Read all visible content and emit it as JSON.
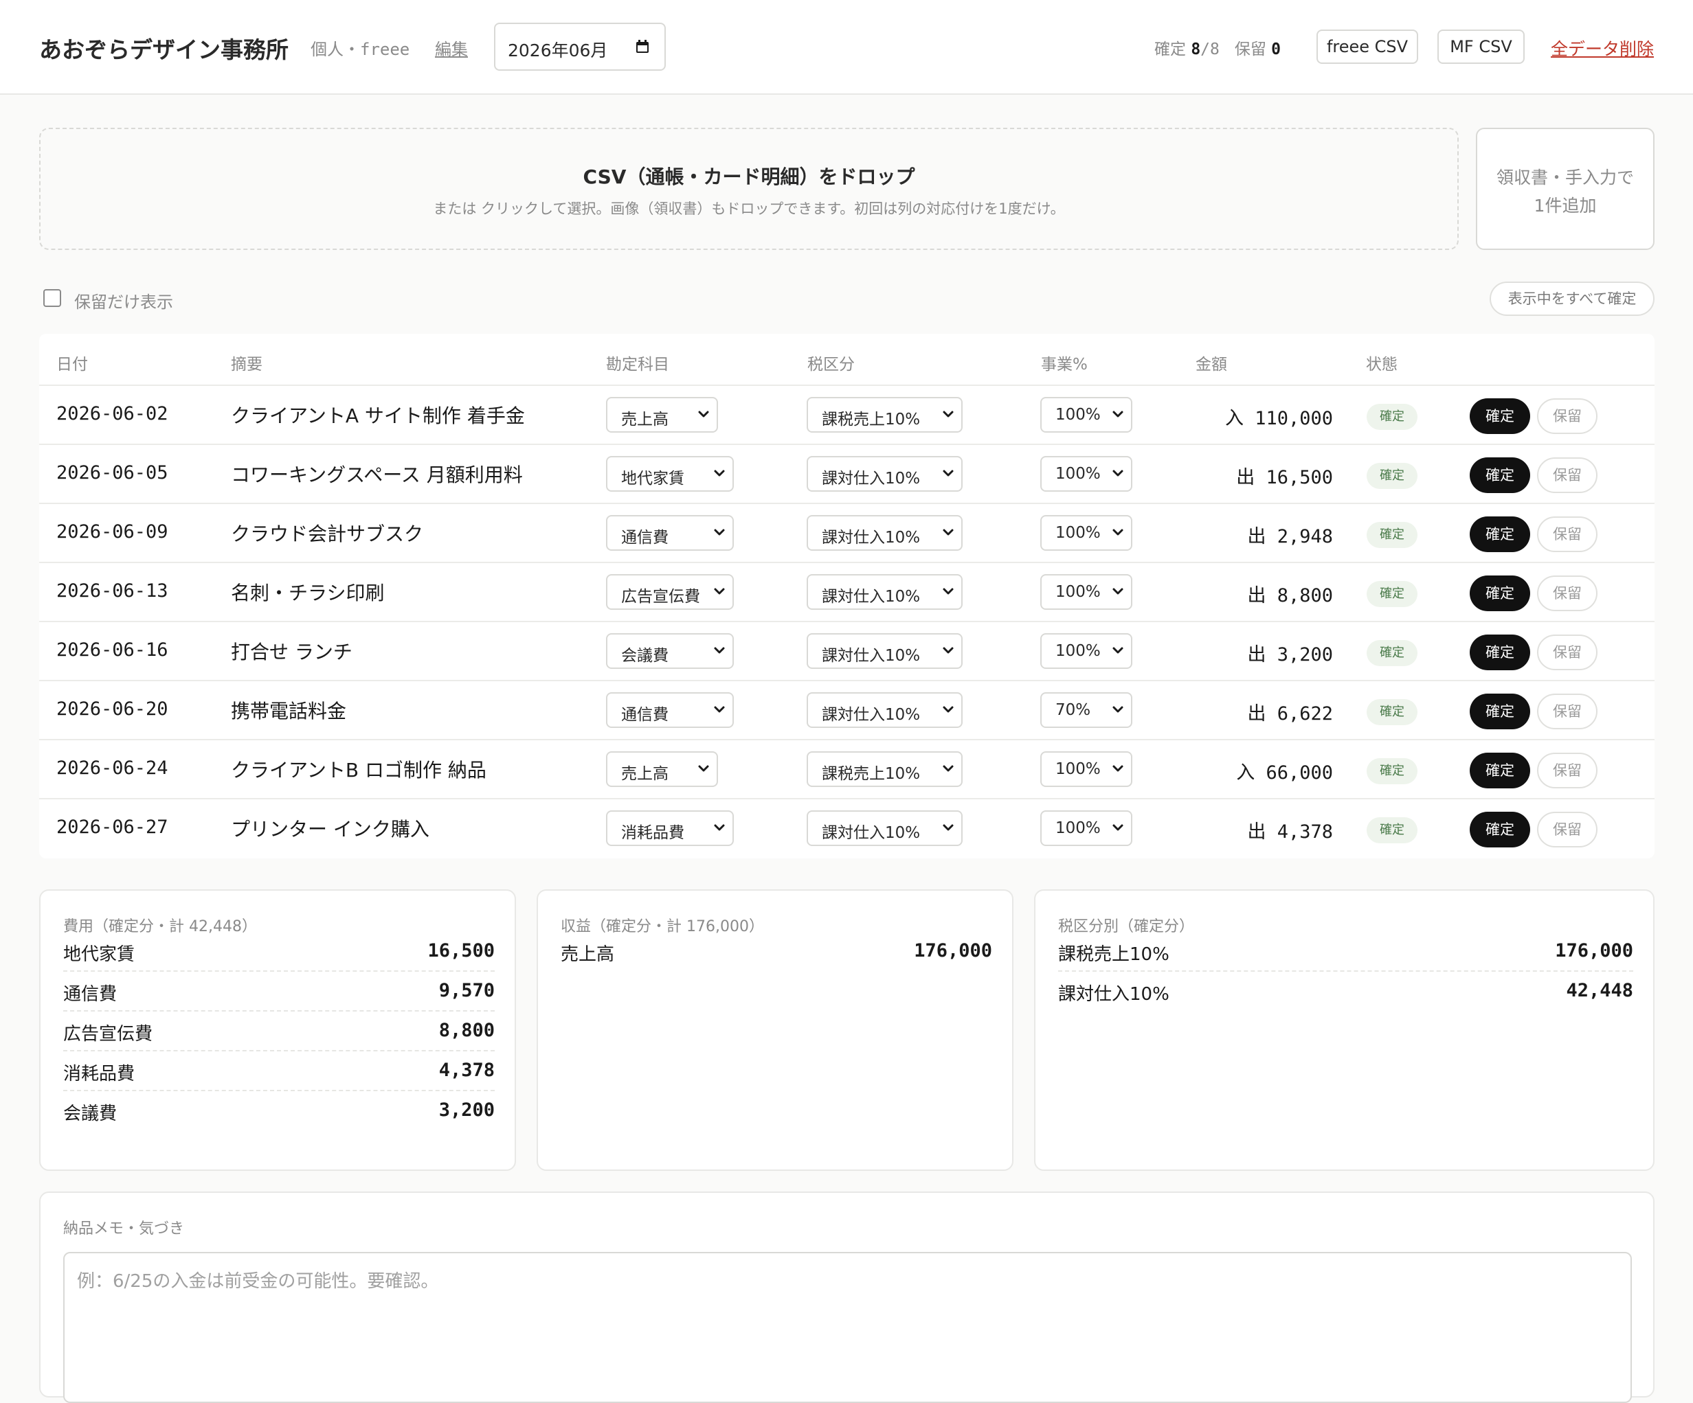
{
  "header": {
    "title": "あおぞらデザイン事務所",
    "profile": "個人・freee",
    "edit_label": "編集",
    "month": "2026年06月",
    "confirmed_label": "確定",
    "confirmed_count": "8",
    "total_count": "/8",
    "hold_label": "保留",
    "hold_count": "0",
    "freee_csv": "freee CSV",
    "mf_csv": "MF CSV",
    "delete_all": "全データ削除"
  },
  "dropzone": {
    "title": "CSV（通帳・カード明細）をドロップ",
    "subtitle": "または クリックして選択。画像（領収書）もドロップできます。初回は列の対応付けを1度だけ。"
  },
  "manual_add": {
    "line1": "領収書・手入力で",
    "line2": "1件追加"
  },
  "filter": {
    "hold_only": "保留だけ表示",
    "confirm_all": "表示中をすべて確定"
  },
  "table": {
    "headers": {
      "date": "日付",
      "desc": "摘要",
      "account": "勘定科目",
      "tax": "税区分",
      "biz": "事業%",
      "amount": "金額",
      "status": "状態"
    },
    "rows": [
      {
        "date": "2026-06-02",
        "desc": "クライアントA サイト制作 着手金",
        "account": "売上高",
        "tax": "課税売上10%",
        "biz": "100%",
        "amount": "入 110,000",
        "status": "確定",
        "confirm": "確定",
        "hold": "保留"
      },
      {
        "date": "2026-06-05",
        "desc": "コワーキングスペース 月額利用料",
        "account": "地代家賃",
        "tax": "課対仕入10%",
        "biz": "100%",
        "amount": "出 16,500",
        "status": "確定",
        "confirm": "確定",
        "hold": "保留"
      },
      {
        "date": "2026-06-09",
        "desc": "クラウド会計サブスク",
        "account": "通信費",
        "tax": "課対仕入10%",
        "biz": "100%",
        "amount": "出 2,948",
        "status": "確定",
        "confirm": "確定",
        "hold": "保留"
      },
      {
        "date": "2026-06-13",
        "desc": "名刺・チラシ印刷",
        "account": "広告宣伝費",
        "tax": "課対仕入10%",
        "biz": "100%",
        "amount": "出 8,800",
        "status": "確定",
        "confirm": "確定",
        "hold": "保留"
      },
      {
        "date": "2026-06-16",
        "desc": "打合せ ランチ",
        "account": "会議費",
        "tax": "課対仕入10%",
        "biz": "100%",
        "amount": "出 3,200",
        "status": "確定",
        "confirm": "確定",
        "hold": "保留"
      },
      {
        "date": "2026-06-20",
        "desc": "携帯電話料金",
        "account": "通信費",
        "tax": "課対仕入10%",
        "biz": "70%",
        "amount": "出 6,622",
        "status": "確定",
        "confirm": "確定",
        "hold": "保留"
      },
      {
        "date": "2026-06-24",
        "desc": "クライアントB ロゴ制作 納品",
        "account": "売上高",
        "tax": "課税売上10%",
        "biz": "100%",
        "amount": "入 66,000",
        "status": "確定",
        "confirm": "確定",
        "hold": "保留"
      },
      {
        "date": "2026-06-27",
        "desc": "プリンター インク購入",
        "account": "消耗品費",
        "tax": "課対仕入10%",
        "biz": "100%",
        "amount": "出 4,378",
        "status": "確定",
        "confirm": "確定",
        "hold": "保留"
      }
    ]
  },
  "summary": {
    "expense": {
      "title": "費用（確定分・計 42,448）",
      "items": [
        {
          "label": "地代家賃",
          "value": "16,500"
        },
        {
          "label": "通信費",
          "value": "9,570"
        },
        {
          "label": "広告宣伝費",
          "value": "8,800"
        },
        {
          "label": "消耗品費",
          "value": "4,378"
        },
        {
          "label": "会議費",
          "value": "3,200"
        }
      ]
    },
    "revenue": {
      "title": "収益（確定分・計 176,000）",
      "items": [
        {
          "label": "売上高",
          "value": "176,000"
        }
      ]
    },
    "tax": {
      "title": "税区分別（確定分）",
      "items": [
        {
          "label": "課税売上10%",
          "value": "176,000"
        },
        {
          "label": "課対仕入10%",
          "value": "42,448"
        }
      ]
    }
  },
  "memo": {
    "title": "納品メモ・気づき",
    "placeholder": "例：6/25の入金は前受金の可能性。要確認。"
  },
  "colors": {
    "accent_dark": "#111111",
    "danger": "#c0392b",
    "badge_bg": "#eef4ec",
    "badge_text": "#4a7a4a"
  }
}
